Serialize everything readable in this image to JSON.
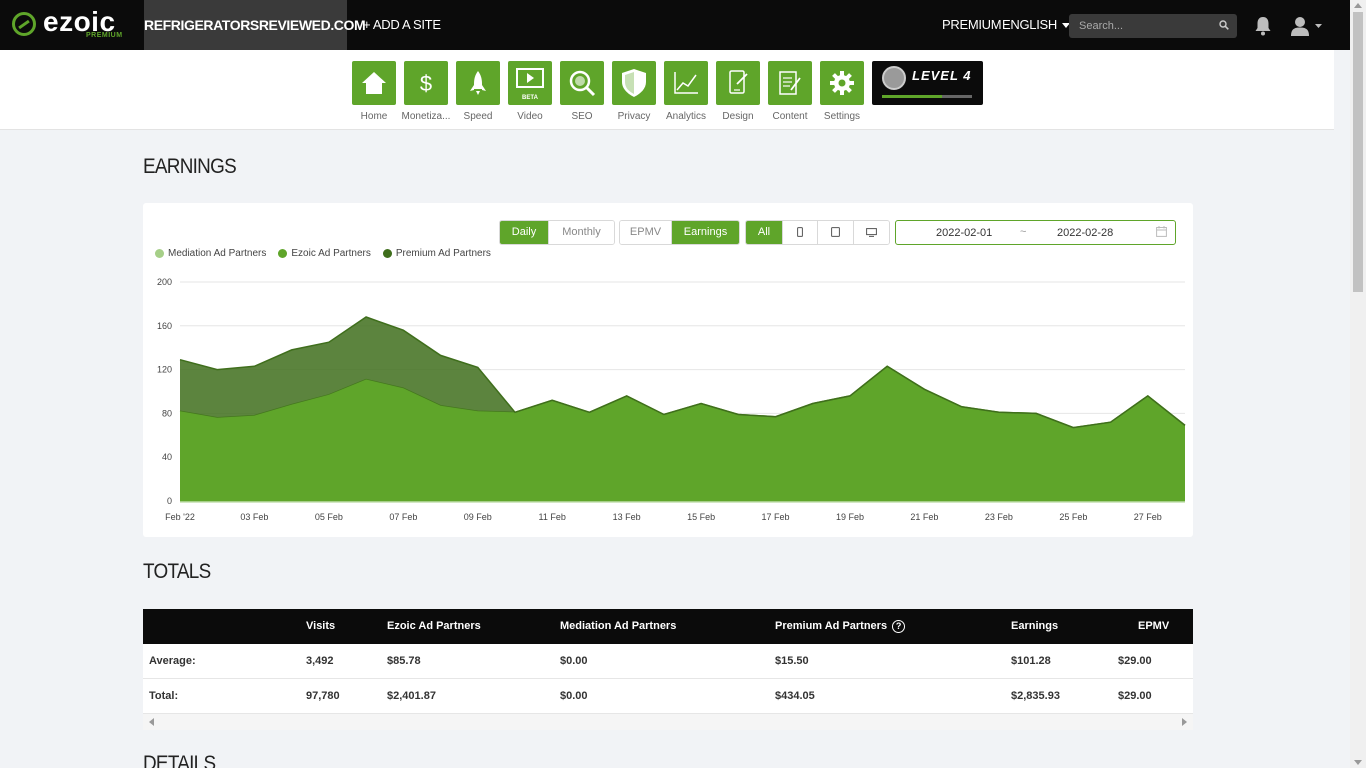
{
  "topbar": {
    "logo_text": "ezoic",
    "logo_sub": "PREMIUM",
    "site_name": "REFRIGERATORSREVIEWED.COM",
    "add_site": "+ ADD A SITE",
    "premium": "PREMIUM",
    "language": "ENGLISH",
    "search_placeholder": "Search..."
  },
  "nav": {
    "items": [
      {
        "label": "Home",
        "icon": "home-icon"
      },
      {
        "label": "Monetiza...",
        "icon": "dollar-icon"
      },
      {
        "label": "Speed",
        "icon": "rocket-icon"
      },
      {
        "label": "Video",
        "icon": "video-icon",
        "badge": "BETA"
      },
      {
        "label": "SEO",
        "icon": "magnifier-icon"
      },
      {
        "label": "Privacy",
        "icon": "shield-icon"
      },
      {
        "label": "Analytics",
        "icon": "line-chart-icon"
      },
      {
        "label": "Design",
        "icon": "design-icon"
      },
      {
        "label": "Content",
        "icon": "document-icon"
      },
      {
        "label": "Settings",
        "icon": "gear-icon"
      }
    ],
    "level_label": "LEVEL 4",
    "level_progress": 0.67,
    "accent": "#5fa52a"
  },
  "earnings": {
    "title": "EARNINGS",
    "period_buttons": [
      "Daily",
      "Monthly"
    ],
    "period_active": "Daily",
    "metric_buttons": [
      "EPMV",
      "Earnings"
    ],
    "metric_active": "Earnings",
    "device_all": "All",
    "device_active": "All",
    "date_start": "2022-02-01",
    "date_sep": "~",
    "date_end": "2022-02-28"
  },
  "chart_data": {
    "type": "area",
    "stacked": true,
    "title": "",
    "xlabel": "",
    "ylabel": "",
    "ylim": [
      0,
      200
    ],
    "yticks": [
      0,
      40,
      80,
      120,
      160,
      200
    ],
    "xtick_labels": [
      "Feb '22",
      "03 Feb",
      "05 Feb",
      "07 Feb",
      "09 Feb",
      "11 Feb",
      "13 Feb",
      "15 Feb",
      "17 Feb",
      "19 Feb",
      "21 Feb",
      "23 Feb",
      "25 Feb",
      "27 Feb"
    ],
    "x": [
      "2022-02-01",
      "2022-02-02",
      "2022-02-03",
      "2022-02-04",
      "2022-02-05",
      "2022-02-06",
      "2022-02-07",
      "2022-02-08",
      "2022-02-09",
      "2022-02-10",
      "2022-02-11",
      "2022-02-12",
      "2022-02-13",
      "2022-02-14",
      "2022-02-15",
      "2022-02-16",
      "2022-02-17",
      "2022-02-18",
      "2022-02-19",
      "2022-02-20",
      "2022-02-21",
      "2022-02-22",
      "2022-02-23",
      "2022-02-24",
      "2022-02-25",
      "2022-02-26",
      "2022-02-27",
      "2022-02-28"
    ],
    "series": [
      {
        "name": "Mediation Ad Partners",
        "color": "#a6cf88",
        "values": [
          0,
          0,
          0,
          0,
          0,
          0,
          0,
          0,
          0,
          0,
          0,
          0,
          0,
          0,
          0,
          0,
          0,
          0,
          0,
          0,
          0,
          0,
          0,
          0,
          0,
          0,
          0,
          0
        ]
      },
      {
        "name": "Ezoic Ad Partners",
        "color": "#5fa52a",
        "values": [
          82,
          76,
          78,
          88,
          97,
          111,
          103,
          87,
          82,
          81,
          92,
          81,
          96,
          79,
          89,
          79,
          77,
          89,
          96,
          123,
          102,
          86,
          81,
          80,
          67,
          72,
          96,
          69
        ]
      },
      {
        "name": "Premium Ad Partners",
        "color": "#3f6e1c",
        "values": [
          47,
          44,
          45,
          50,
          48,
          57,
          53,
          46,
          40,
          0,
          0,
          0,
          0,
          0,
          0,
          0,
          0,
          0,
          0,
          0,
          0,
          0,
          0,
          0,
          0,
          0,
          0,
          0
        ]
      }
    ],
    "legend_position": "top-left",
    "grid": true
  },
  "totals": {
    "title": "TOTALS",
    "headers": [
      "",
      "Visits",
      "Ezoic Ad Partners",
      "Mediation Ad Partners",
      "Premium Ad Partners",
      "Earnings",
      "EPMV"
    ],
    "rows": [
      [
        "Average:",
        "3,492",
        "$85.78",
        "$0.00",
        "$15.50",
        "$101.28",
        "$29.00"
      ],
      [
        "Total:",
        "97,780",
        "$2,401.87",
        "$0.00",
        "$434.05",
        "$2,835.93",
        "$29.00"
      ]
    ]
  },
  "details": {
    "title": "DETAILS"
  }
}
